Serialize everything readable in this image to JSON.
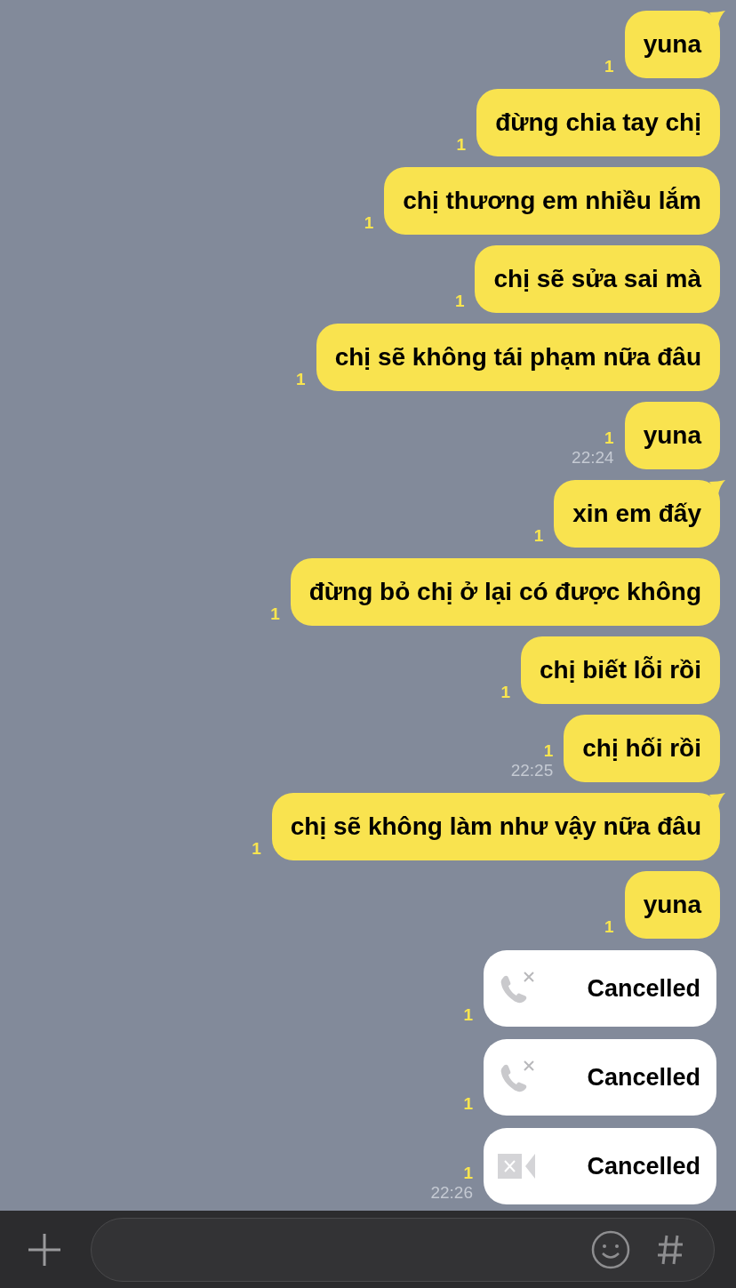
{
  "messages": [
    {
      "kind": "text",
      "text": "yuna",
      "unread": "1",
      "tail": true
    },
    {
      "kind": "text",
      "text": "đừng chia tay chị",
      "unread": "1",
      "tail": false
    },
    {
      "kind": "text",
      "text": "chị thương em nhiều lắm",
      "unread": "1",
      "tail": false
    },
    {
      "kind": "text",
      "text": "chị sẽ sửa sai mà",
      "unread": "1",
      "tail": false
    },
    {
      "kind": "text",
      "text": "chị sẽ không tái phạm nữa đâu",
      "unread": "1",
      "tail": false
    },
    {
      "kind": "text",
      "text": "yuna",
      "unread": "1",
      "time": "22:24",
      "tail": false
    },
    {
      "kind": "text",
      "text": "xin em đấy",
      "unread": "1",
      "tail": true
    },
    {
      "kind": "text",
      "text": "đừng bỏ chị ở lại có được không",
      "unread": "1",
      "tail": false
    },
    {
      "kind": "text",
      "text": "chị biết lỗi rồi",
      "unread": "1",
      "tail": false
    },
    {
      "kind": "text",
      "text": "chị hối rồi",
      "unread": "1",
      "time": "22:25",
      "tail": false
    },
    {
      "kind": "text",
      "text": "chị sẽ không làm như vậy nữa đâu",
      "unread": "1",
      "tail": true
    },
    {
      "kind": "text",
      "text": "yuna",
      "unread": "1",
      "tail": false
    },
    {
      "kind": "voice_call",
      "text": "Cancelled",
      "unread": "1"
    },
    {
      "kind": "voice_call",
      "text": "Cancelled",
      "unread": "1"
    },
    {
      "kind": "video_call",
      "text": "Cancelled",
      "unread": "1",
      "time": "22:26"
    }
  ]
}
